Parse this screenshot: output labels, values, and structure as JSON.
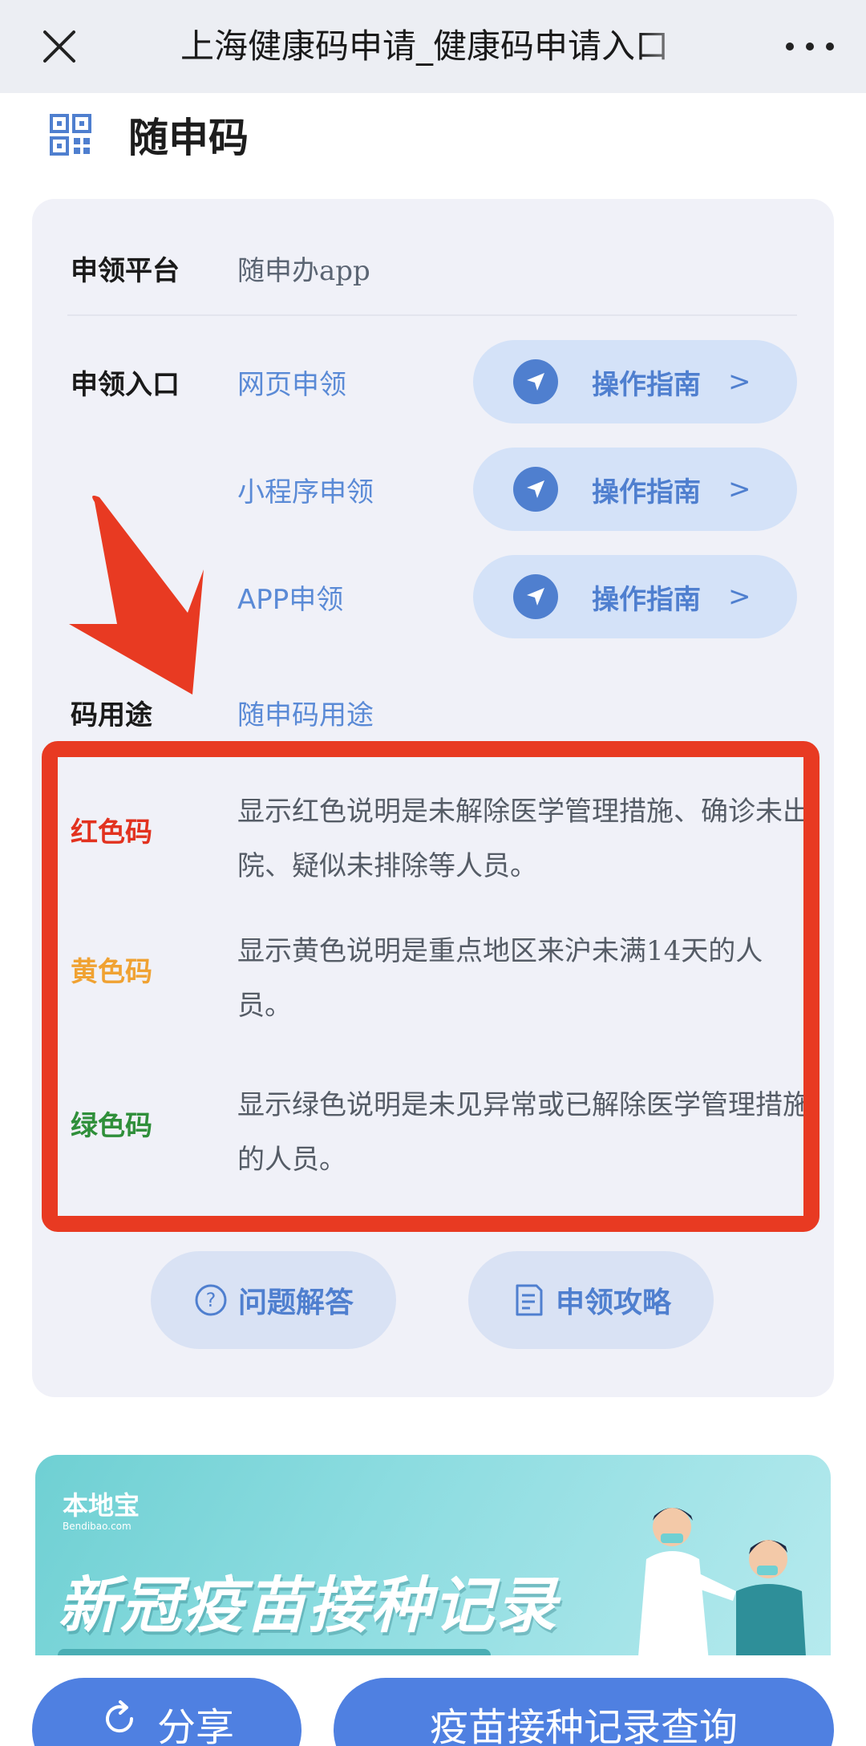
{
  "topbar": {
    "title": "上海健康码申请_健康码申请入口"
  },
  "section": {
    "title": "随申码"
  },
  "platform": {
    "label": "申领平台",
    "value": "随申办app"
  },
  "entries": {
    "label": "申领入口",
    "items": [
      {
        "name": "网页申领",
        "button": "操作指南",
        "chevron": ">"
      },
      {
        "name": "小程序申领",
        "button": "操作指南",
        "chevron": ">"
      },
      {
        "name": "APP申领",
        "button": "操作指南",
        "chevron": ">"
      }
    ]
  },
  "usage": {
    "label": "码用途",
    "link": "随申码用途"
  },
  "codes": [
    {
      "label": "红色码",
      "color": "#e2321f",
      "desc": "显示红色说明是未解除医学管理措施、确诊未出院、疑似未排除等人员。"
    },
    {
      "label": "黄色码",
      "color": "#f0a232",
      "desc": "显示黄色说明是重点地区来沪未满14天的人员。"
    },
    {
      "label": "绿色码",
      "color": "#2f8f3a",
      "desc": "显示绿色说明是未见异常或已解除医学管理措施的人员。"
    }
  ],
  "actions": {
    "faq": "问题解答",
    "strategy": "申领攻略"
  },
  "banner": {
    "logo": "本地宝",
    "logo_sub": "Bendibao.com",
    "title": "新冠疫苗接种记录"
  },
  "bottom": {
    "share": "分享",
    "query": "疫苗接种记录查询"
  },
  "colors": {
    "accent": "#4f80e1",
    "highlight_border": "#e83a22",
    "card_bg": "#f0f1f8"
  }
}
